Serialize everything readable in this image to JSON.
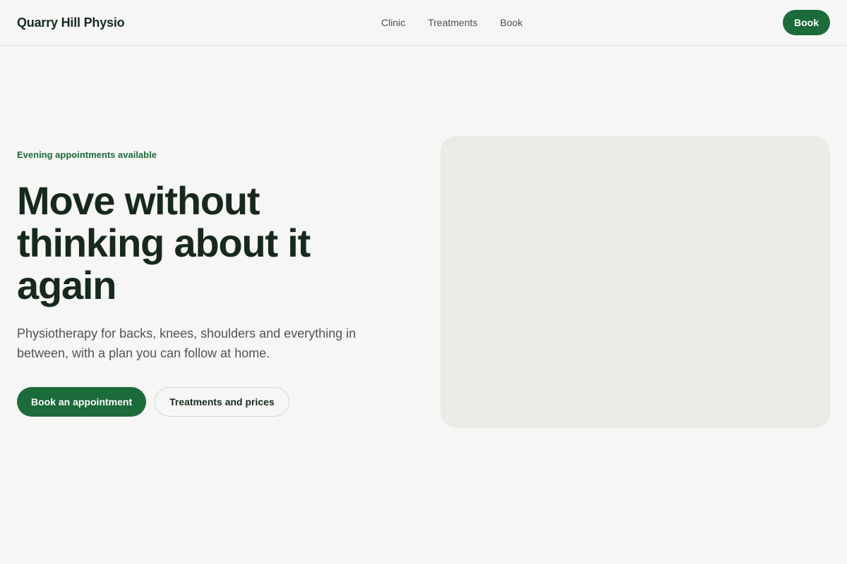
{
  "header": {
    "brand": "Quarry Hill Physio",
    "nav": [
      {
        "label": "Clinic"
      },
      {
        "label": "Treatments"
      },
      {
        "label": "Book"
      }
    ],
    "cta_label": "Book"
  },
  "hero": {
    "eyebrow": "Evening appointments available",
    "title": "Move without thinking about it again",
    "subtitle": "Physiotherapy for backs, knees, shoulders and everything in between, with a plan you can follow at home.",
    "primary_cta": "Book an appointment",
    "secondary_cta": "Treatments and prices"
  },
  "colors": {
    "accent": "#1c6b3b",
    "text": "#17291f",
    "background": "#f6f6f4",
    "media_placeholder": "#eaebe7"
  }
}
